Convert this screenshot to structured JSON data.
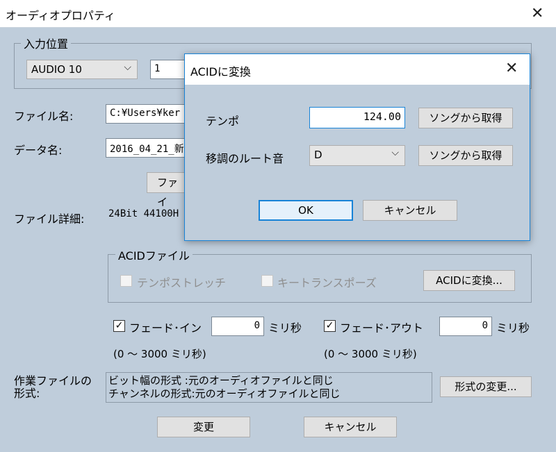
{
  "window": {
    "title": "オーディオプロパティ"
  },
  "input_position": {
    "legend": "入力位置",
    "track": "AUDIO 10",
    "index": "1"
  },
  "file_name": {
    "label": "ファイル名:",
    "value": "C:¥Users¥ker"
  },
  "data_name": {
    "label": "データ名:",
    "value": "2016_04_21_新"
  },
  "file_button": {
    "label": "ファイ"
  },
  "file_details": {
    "label": "ファイル詳細:",
    "value": "24Bit 44100H"
  },
  "acid": {
    "legend": "ACIDファイル",
    "tempo_stretch": "テンポストレッチ",
    "key_transpose": "キートランスポーズ",
    "convert_button": "ACIDに変換..."
  },
  "fade_in": {
    "label": "フェード･イン",
    "value": "0",
    "unit": "ミリ秒",
    "range": "(0 ～ 3000 ミリ秒)",
    "checked": true
  },
  "fade_out": {
    "label": "フェード･アウト",
    "value": "0",
    "unit": "ミリ秒",
    "range": "(0 ～ 3000 ミリ秒)",
    "checked": true
  },
  "work_format": {
    "label_line1": "作業ファイルの",
    "label_line2": "形式:",
    "line1": "ビット幅の形式 :元のオーディオファイルと同じ",
    "line2": "チャンネルの形式:元のオーディオファイルと同じ",
    "change_button": "形式の変更..."
  },
  "footer": {
    "ok_label": "変更",
    "cancel_label": "キャンセル"
  },
  "dialog": {
    "title": "ACIDに変換",
    "tempo_label": "テンポ",
    "tempo_value": "124.00",
    "tempo_button": "ソングから取得",
    "key_label": "移調のルート音",
    "key_value": "D",
    "key_button": "ソングから取得",
    "ok_label": "OK",
    "cancel_label": "キャンセル"
  }
}
